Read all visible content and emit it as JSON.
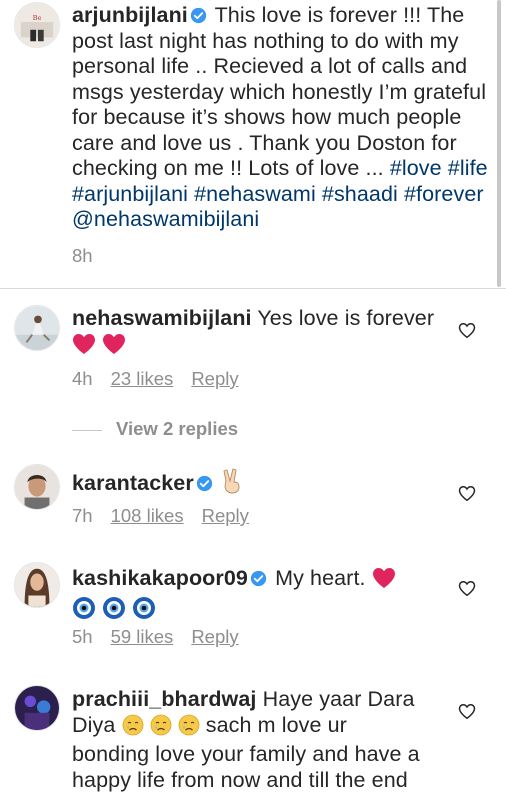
{
  "caption": {
    "username": "arjunbijlani",
    "text": "This love is forever !!! The post last night has nothing to do with my personal life .. Recieved a lot of calls and msgs yesterday which honestly I’m grateful for because it’s shows how much people care and love us . Thank you Doston for checking on me !! Lots of love ...",
    "tags": "#love #life #arjunbijlani #nehaswami #shaadi #forever @nehaswamibijlani",
    "time": "8h"
  },
  "comments": [
    {
      "username": "nehaswamibijlani",
      "text": "Yes love is forever",
      "time": "4h",
      "likes": "23 likes",
      "reply": "Reply"
    },
    {
      "username": "karantacker",
      "text": "",
      "time": "7h",
      "likes": "108 likes",
      "reply": "Reply"
    },
    {
      "username": "kashikakapoor09",
      "text": "My heart.",
      "time": "5h",
      "likes": "59 likes",
      "reply": "Reply"
    },
    {
      "username": "prachiii_bhardwaj",
      "text_1": "Haye yaar Dara",
      "text_2": "Diya",
      "text_3": "sach m love ur",
      "text_4": "bonding love your family and have a",
      "text_5": "happy life from now and till the end"
    }
  ],
  "view_replies": "View 2 replies",
  "colors": {
    "link": "#00376b",
    "meta": "#8e8e8e",
    "verified": "#3897f0",
    "heart": "#e0245e"
  },
  "icons": [
    "verified-badge-icon",
    "like-heart-icon",
    "red-heart-emoji",
    "victory-hand-emoji",
    "evil-eye-emoji",
    "crying-face-emoji"
  ]
}
